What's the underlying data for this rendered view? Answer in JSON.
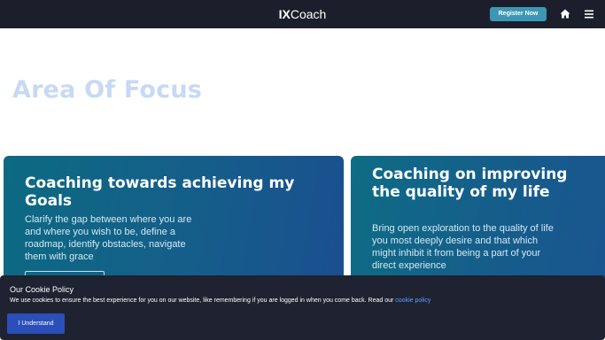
{
  "header": {
    "logo_bold": "IX",
    "logo_rest": "Coach",
    "register_label": "Register Now",
    "home_icon": "home-icon",
    "menu_icon": "hamburger-menu-icon"
  },
  "main": {
    "section_title": "Area Of Focus",
    "cards": [
      {
        "title": "Coaching towards achieving my Goals",
        "description": "Clarify the gap between where you are and where you wish to be, define a roadmap, identify obstacles, navigate them with grace"
      },
      {
        "title": "Coaching on improving the quality of my life",
        "description": "Bring open exploration to the quality of life you most deeply desire and that which might inhibit it from being a part of your direct experience"
      }
    ]
  },
  "cookie": {
    "title": "Our Cookie Policy",
    "text": "We use cookies to ensure the best experience for you on our website, like remembering if you are logged in when you come back. Read our ",
    "link_text": "cookie policy",
    "button_label": "I Understand"
  },
  "colors": {
    "header_bg": "#1c1f2b",
    "register_btn": "#3c97b4",
    "section_title": "#c7d9f4",
    "card_gradient_start": "#0c6a82",
    "card_gradient_end": "#1a4f8f",
    "cookie_bg": "#1f2230",
    "cookie_btn": "#2a4fb8",
    "cookie_link": "#5aa3ff"
  }
}
